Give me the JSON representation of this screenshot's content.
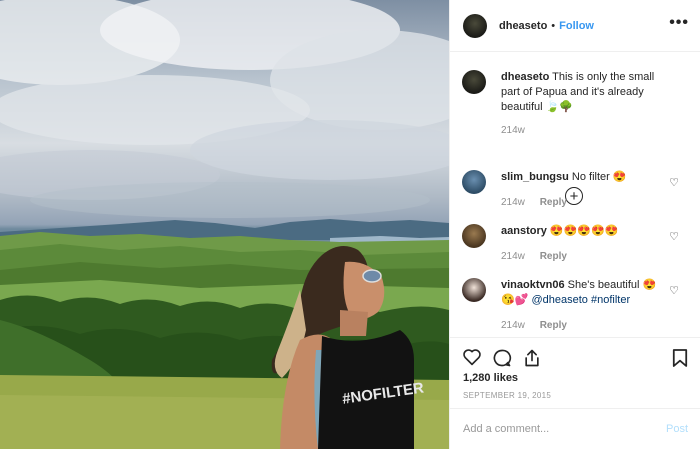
{
  "post": {
    "author": "dheaseto",
    "dot": "•",
    "follow_label": "Follow",
    "more_label": "•••",
    "caption": "This is only the small part of Papua and it's already beautiful",
    "caption_emoji": "🍃🌳",
    "caption_time": "214w",
    "shirt_text": "#NOFILTER"
  },
  "comments": [
    {
      "user": "slim_bungsu",
      "text": "No filter",
      "emoji": "😍",
      "time": "214w",
      "reply": "Reply"
    },
    {
      "user": "aanstory",
      "text": "",
      "emoji": "😍😍😍😍😍",
      "time": "214w",
      "reply": "Reply"
    },
    {
      "user": "vinaoktvn06",
      "text": "She's beautiful",
      "emoji": "😍",
      "emoji2": "😘💕",
      "mention": "@dheaseto",
      "hashtag": "#nofilter",
      "time": "214w",
      "reply": "Reply"
    }
  ],
  "load_more_label": "+",
  "likes": "1,280 likes",
  "date": "SEPTEMBER 19, 2015",
  "add_comment": {
    "placeholder": "Add a comment...",
    "post_label": "Post"
  },
  "colors": {
    "link": "#3897f0",
    "post_disabled": "#b2dffc",
    "border": "#efefef"
  }
}
